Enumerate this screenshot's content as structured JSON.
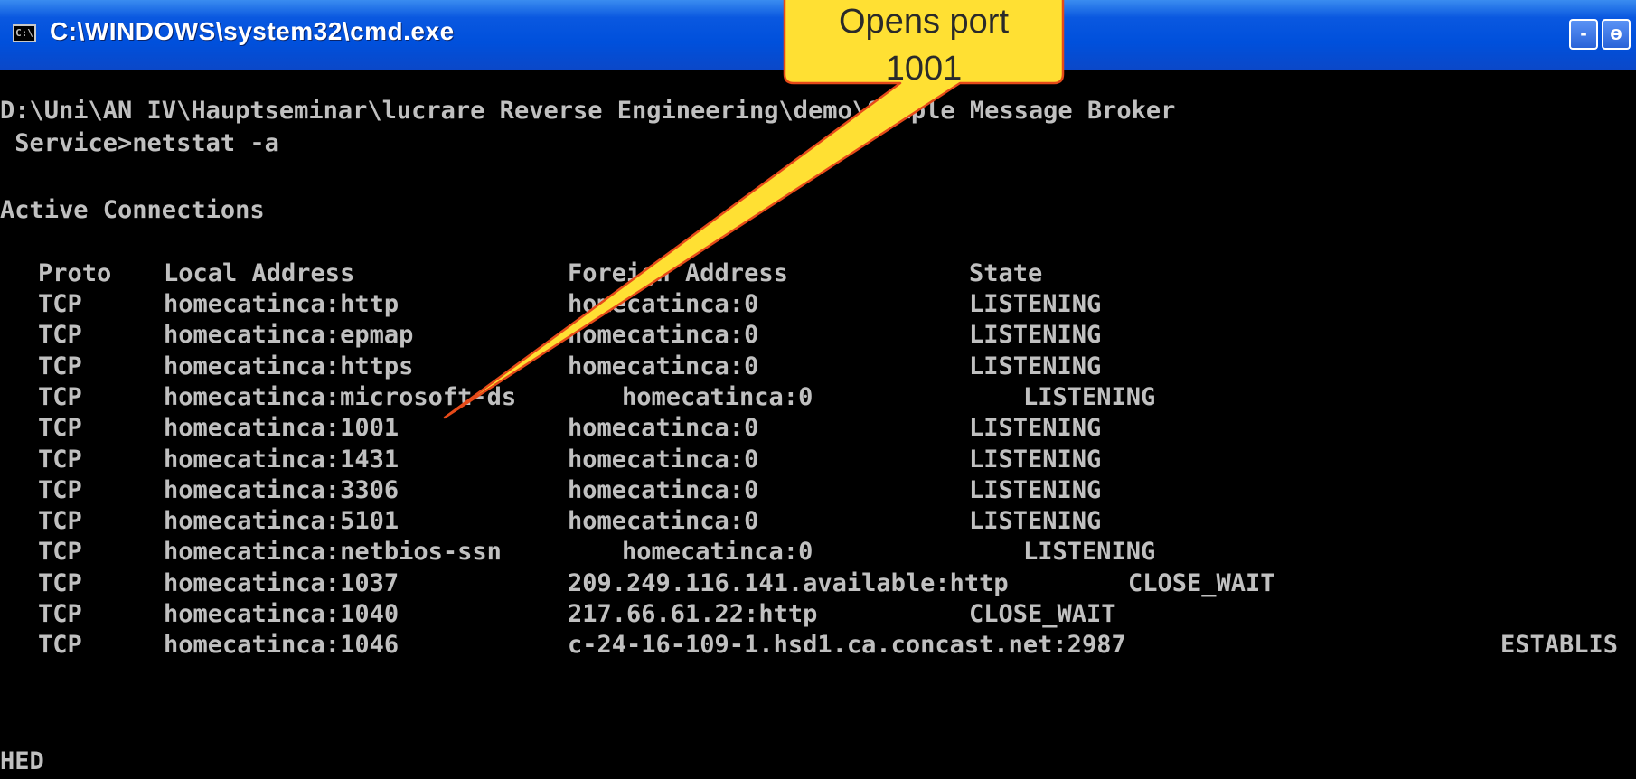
{
  "window": {
    "title": "C:\\WINDOWS\\system32\\cmd.exe",
    "icon": "cmd-icon",
    "minimize_label": "-",
    "maximize_label": "ɵ"
  },
  "console": {
    "prompt_line1": "D:\\Uni\\AN IV\\Hauptseminar\\lucrare Reverse Engineering\\demo\\Simple Message Broker",
    "prompt_line2": " Service>netstat -a",
    "heading": "Active Connections",
    "columns": {
      "proto": "Proto",
      "local": "Local Address",
      "foreign": "Foreign Address",
      "state": "State"
    },
    "rows": [
      {
        "proto": "TCP",
        "local": "homecatinca:http",
        "foreign": "homecatinca:0",
        "state": "LISTENING"
      },
      {
        "proto": "TCP",
        "local": "homecatinca:epmap",
        "foreign": "homecatinca:0",
        "state": "LISTENING"
      },
      {
        "proto": "TCP",
        "local": "homecatinca:https",
        "foreign": "homecatinca:0",
        "state": "LISTENING"
      },
      {
        "proto": "TCP",
        "local": "homecatinca:microsoft-ds",
        "foreign": "homecatinca:0",
        "state": "LISTENING"
      },
      {
        "proto": "TCP",
        "local": "homecatinca:1001",
        "foreign": "homecatinca:0",
        "state": "LISTENING"
      },
      {
        "proto": "TCP",
        "local": "homecatinca:1431",
        "foreign": "homecatinca:0",
        "state": "LISTENING"
      },
      {
        "proto": "TCP",
        "local": "homecatinca:3306",
        "foreign": "homecatinca:0",
        "state": "LISTENING"
      },
      {
        "proto": "TCP",
        "local": "homecatinca:5101",
        "foreign": "homecatinca:0",
        "state": "LISTENING"
      },
      {
        "proto": "TCP",
        "local": "homecatinca:netbios-ssn",
        "foreign": "homecatinca:0",
        "state": "LISTENING"
      },
      {
        "proto": "TCP",
        "local": "homecatinca:1037",
        "foreign": "209.249.116.141.available:http",
        "state": "CLOSE_WAIT"
      },
      {
        "proto": "TCP",
        "local": "homecatinca:1040",
        "foreign": "217.66.61.22:http",
        "state": "CLOSE_WAIT"
      },
      {
        "proto": "TCP",
        "local": "homecatinca:1046",
        "foreign": "c-24-16-109-1.hsd1.ca.concast.net:2987",
        "state": "ESTABLIS"
      }
    ],
    "wrap_tail": "HED"
  },
  "callout": {
    "text_line1": "Opens port",
    "text_line2": "1001",
    "fill_color": "#FFE033",
    "border_color": "#E64A19"
  }
}
